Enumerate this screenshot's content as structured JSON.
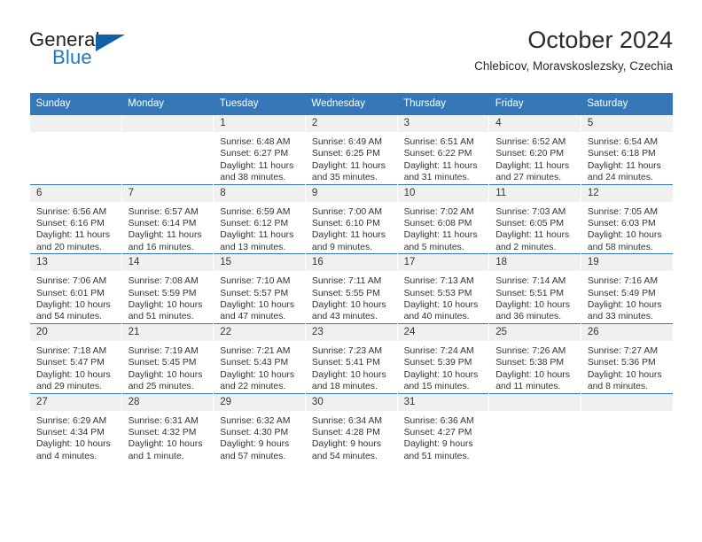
{
  "brand": {
    "word_top": "General",
    "word_bottom": "Blue",
    "triangle_color": "#1261a8",
    "blue_color": "#1c7bc4"
  },
  "header": {
    "title": "October 2024",
    "subtitle": "Chlebicov, Moravskoslezsky, Czechia"
  },
  "theme": {
    "header_bg": "#3577b7",
    "daynum_bg": "#f0f0f0",
    "grid_line": "#3577b7"
  },
  "labels": {
    "sunrise": "Sunrise:",
    "sunset": "Sunset:",
    "daylight": "Daylight:"
  },
  "weekdays": [
    "Sunday",
    "Monday",
    "Tuesday",
    "Wednesday",
    "Thursday",
    "Friday",
    "Saturday"
  ],
  "weeks": [
    [
      {
        "day": "",
        "sunrise": "",
        "sunset": "",
        "daylight_line1": "",
        "daylight_line2": ""
      },
      {
        "day": "",
        "sunrise": "",
        "sunset": "",
        "daylight_line1": "",
        "daylight_line2": ""
      },
      {
        "day": "1",
        "sunrise": "Sunrise: 6:48 AM",
        "sunset": "Sunset: 6:27 PM",
        "daylight_line1": "Daylight: 11 hours",
        "daylight_line2": "and 38 minutes."
      },
      {
        "day": "2",
        "sunrise": "Sunrise: 6:49 AM",
        "sunset": "Sunset: 6:25 PM",
        "daylight_line1": "Daylight: 11 hours",
        "daylight_line2": "and 35 minutes."
      },
      {
        "day": "3",
        "sunrise": "Sunrise: 6:51 AM",
        "sunset": "Sunset: 6:22 PM",
        "daylight_line1": "Daylight: 11 hours",
        "daylight_line2": "and 31 minutes."
      },
      {
        "day": "4",
        "sunrise": "Sunrise: 6:52 AM",
        "sunset": "Sunset: 6:20 PM",
        "daylight_line1": "Daylight: 11 hours",
        "daylight_line2": "and 27 minutes."
      },
      {
        "day": "5",
        "sunrise": "Sunrise: 6:54 AM",
        "sunset": "Sunset: 6:18 PM",
        "daylight_line1": "Daylight: 11 hours",
        "daylight_line2": "and 24 minutes."
      }
    ],
    [
      {
        "day": "6",
        "sunrise": "Sunrise: 6:56 AM",
        "sunset": "Sunset: 6:16 PM",
        "daylight_line1": "Daylight: 11 hours",
        "daylight_line2": "and 20 minutes."
      },
      {
        "day": "7",
        "sunrise": "Sunrise: 6:57 AM",
        "sunset": "Sunset: 6:14 PM",
        "daylight_line1": "Daylight: 11 hours",
        "daylight_line2": "and 16 minutes."
      },
      {
        "day": "8",
        "sunrise": "Sunrise: 6:59 AM",
        "sunset": "Sunset: 6:12 PM",
        "daylight_line1": "Daylight: 11 hours",
        "daylight_line2": "and 13 minutes."
      },
      {
        "day": "9",
        "sunrise": "Sunrise: 7:00 AM",
        "sunset": "Sunset: 6:10 PM",
        "daylight_line1": "Daylight: 11 hours",
        "daylight_line2": "and 9 minutes."
      },
      {
        "day": "10",
        "sunrise": "Sunrise: 7:02 AM",
        "sunset": "Sunset: 6:08 PM",
        "daylight_line1": "Daylight: 11 hours",
        "daylight_line2": "and 5 minutes."
      },
      {
        "day": "11",
        "sunrise": "Sunrise: 7:03 AM",
        "sunset": "Sunset: 6:05 PM",
        "daylight_line1": "Daylight: 11 hours",
        "daylight_line2": "and 2 minutes."
      },
      {
        "day": "12",
        "sunrise": "Sunrise: 7:05 AM",
        "sunset": "Sunset: 6:03 PM",
        "daylight_line1": "Daylight: 10 hours",
        "daylight_line2": "and 58 minutes."
      }
    ],
    [
      {
        "day": "13",
        "sunrise": "Sunrise: 7:06 AM",
        "sunset": "Sunset: 6:01 PM",
        "daylight_line1": "Daylight: 10 hours",
        "daylight_line2": "and 54 minutes."
      },
      {
        "day": "14",
        "sunrise": "Sunrise: 7:08 AM",
        "sunset": "Sunset: 5:59 PM",
        "daylight_line1": "Daylight: 10 hours",
        "daylight_line2": "and 51 minutes."
      },
      {
        "day": "15",
        "sunrise": "Sunrise: 7:10 AM",
        "sunset": "Sunset: 5:57 PM",
        "daylight_line1": "Daylight: 10 hours",
        "daylight_line2": "and 47 minutes."
      },
      {
        "day": "16",
        "sunrise": "Sunrise: 7:11 AM",
        "sunset": "Sunset: 5:55 PM",
        "daylight_line1": "Daylight: 10 hours",
        "daylight_line2": "and 43 minutes."
      },
      {
        "day": "17",
        "sunrise": "Sunrise: 7:13 AM",
        "sunset": "Sunset: 5:53 PM",
        "daylight_line1": "Daylight: 10 hours",
        "daylight_line2": "and 40 minutes."
      },
      {
        "day": "18",
        "sunrise": "Sunrise: 7:14 AM",
        "sunset": "Sunset: 5:51 PM",
        "daylight_line1": "Daylight: 10 hours",
        "daylight_line2": "and 36 minutes."
      },
      {
        "day": "19",
        "sunrise": "Sunrise: 7:16 AM",
        "sunset": "Sunset: 5:49 PM",
        "daylight_line1": "Daylight: 10 hours",
        "daylight_line2": "and 33 minutes."
      }
    ],
    [
      {
        "day": "20",
        "sunrise": "Sunrise: 7:18 AM",
        "sunset": "Sunset: 5:47 PM",
        "daylight_line1": "Daylight: 10 hours",
        "daylight_line2": "and 29 minutes."
      },
      {
        "day": "21",
        "sunrise": "Sunrise: 7:19 AM",
        "sunset": "Sunset: 5:45 PM",
        "daylight_line1": "Daylight: 10 hours",
        "daylight_line2": "and 25 minutes."
      },
      {
        "day": "22",
        "sunrise": "Sunrise: 7:21 AM",
        "sunset": "Sunset: 5:43 PM",
        "daylight_line1": "Daylight: 10 hours",
        "daylight_line2": "and 22 minutes."
      },
      {
        "day": "23",
        "sunrise": "Sunrise: 7:23 AM",
        "sunset": "Sunset: 5:41 PM",
        "daylight_line1": "Daylight: 10 hours",
        "daylight_line2": "and 18 minutes."
      },
      {
        "day": "24",
        "sunrise": "Sunrise: 7:24 AM",
        "sunset": "Sunset: 5:39 PM",
        "daylight_line1": "Daylight: 10 hours",
        "daylight_line2": "and 15 minutes."
      },
      {
        "day": "25",
        "sunrise": "Sunrise: 7:26 AM",
        "sunset": "Sunset: 5:38 PM",
        "daylight_line1": "Daylight: 10 hours",
        "daylight_line2": "and 11 minutes."
      },
      {
        "day": "26",
        "sunrise": "Sunrise: 7:27 AM",
        "sunset": "Sunset: 5:36 PM",
        "daylight_line1": "Daylight: 10 hours",
        "daylight_line2": "and 8 minutes."
      }
    ],
    [
      {
        "day": "27",
        "sunrise": "Sunrise: 6:29 AM",
        "sunset": "Sunset: 4:34 PM",
        "daylight_line1": "Daylight: 10 hours",
        "daylight_line2": "and 4 minutes."
      },
      {
        "day": "28",
        "sunrise": "Sunrise: 6:31 AM",
        "sunset": "Sunset: 4:32 PM",
        "daylight_line1": "Daylight: 10 hours",
        "daylight_line2": "and 1 minute."
      },
      {
        "day": "29",
        "sunrise": "Sunrise: 6:32 AM",
        "sunset": "Sunset: 4:30 PM",
        "daylight_line1": "Daylight: 9 hours",
        "daylight_line2": "and 57 minutes."
      },
      {
        "day": "30",
        "sunrise": "Sunrise: 6:34 AM",
        "sunset": "Sunset: 4:28 PM",
        "daylight_line1": "Daylight: 9 hours",
        "daylight_line2": "and 54 minutes."
      },
      {
        "day": "31",
        "sunrise": "Sunrise: 6:36 AM",
        "sunset": "Sunset: 4:27 PM",
        "daylight_line1": "Daylight: 9 hours",
        "daylight_line2": "and 51 minutes."
      },
      {
        "day": "",
        "sunrise": "",
        "sunset": "",
        "daylight_line1": "",
        "daylight_line2": ""
      },
      {
        "day": "",
        "sunrise": "",
        "sunset": "",
        "daylight_line1": "",
        "daylight_line2": ""
      }
    ]
  ]
}
